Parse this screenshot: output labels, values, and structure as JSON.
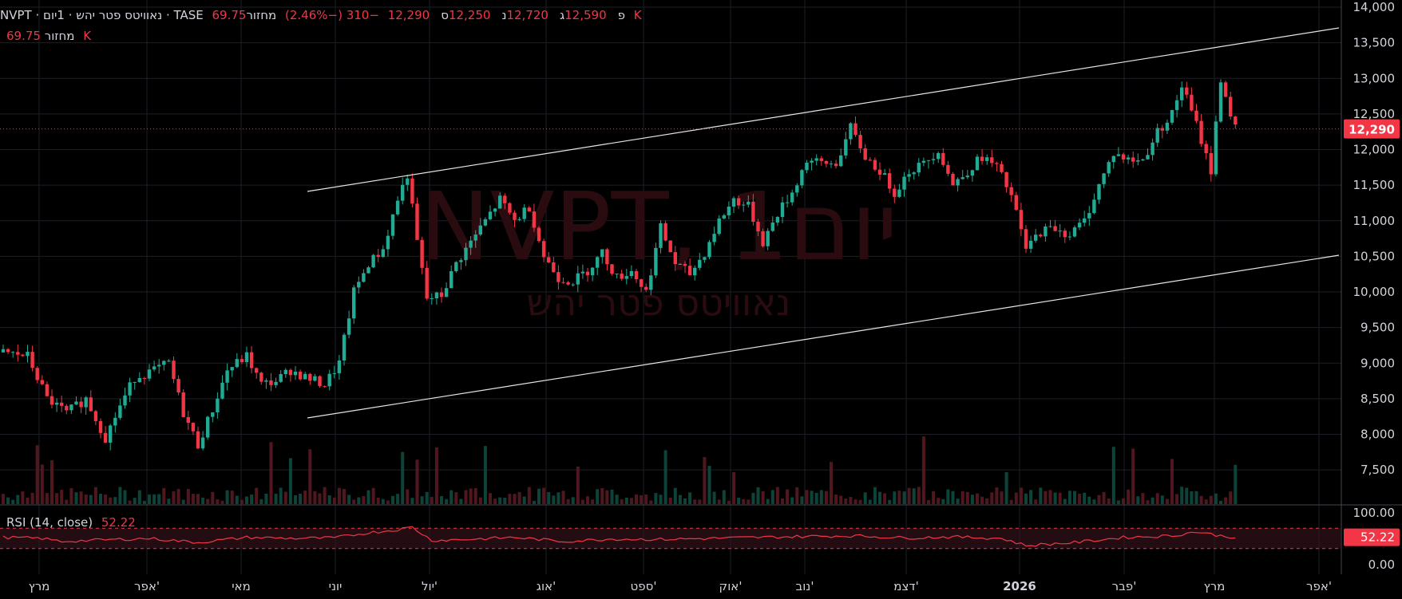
{
  "header": {
    "line1_parts": [
      "NVPT",
      "·",
      "נאוויטס פטר יהש",
      "·",
      "1יום",
      "·",
      "TASE"
    ],
    "ohlc": [
      {
        "label": "פ",
        "value": "12,590"
      },
      {
        "label": "ג",
        "value": "12,720"
      },
      {
        "label": "נ",
        "value": "12,250"
      },
      {
        "label": "ס",
        "value": "12,290"
      }
    ],
    "change": "−310 (−2.46%)",
    "volume_label": "מחזור",
    "volume_value": "69.75 K",
    "line2_label": "מחזור",
    "line2_value": "69.75 K"
  },
  "watermark": {
    "big": "NVPT, 1יום",
    "small": "נאוויטס פטר יהש"
  },
  "price_badge": "12,290",
  "rsi": {
    "label": "RSI (14, close)",
    "value": "52.22",
    "badge": "52.22"
  },
  "colors": {
    "up": "#22ab94",
    "down": "#f23645",
    "grid": "#1c1f26",
    "rsi_line": "#f23645",
    "rsi_band": "#3a1620"
  },
  "chart_data": {
    "type": "candlestick",
    "title": "NVPT · נאוויטס פטר יהש · 1יום · TASE",
    "y_axis_ticks": [
      "14,000",
      "13,500",
      "13,000",
      "12,500",
      "12,000",
      "11,500",
      "11,000",
      "10,500",
      "10,000",
      "9,500",
      "9,000",
      "8,500",
      "8,000",
      "7,500"
    ],
    "ylim": [
      7300,
      14000
    ],
    "x_axis_ticks": [
      "מרץ",
      "אפר'",
      "מאי",
      "יוני",
      "יול'",
      "אוג'",
      "ספט'",
      "אוק'",
      "נוב'",
      "דצמ'",
      "2026",
      "פבר'",
      "מרץ",
      "אפר'"
    ],
    "rsi_axis_ticks": [
      "100.00",
      "0.00"
    ],
    "rsi_levels": [
      70,
      30
    ],
    "last_close": 12290,
    "channel_lines": [
      {
        "from": [
          "יוני",
          8400
        ],
        "to": [
          "אפר'",
          13700
        ]
      },
      {
        "from": [
          "יוני",
          11500
        ],
        "to": [
          "אפר'",
          10600
        ]
      }
    ],
    "price_path": [
      [
        0,
        9150
      ],
      [
        5,
        9100
      ],
      [
        9,
        8500
      ],
      [
        13,
        8300
      ],
      [
        17,
        8500
      ],
      [
        21,
        7950
      ],
      [
        24,
        8400
      ],
      [
        27,
        8800
      ],
      [
        31,
        8900
      ],
      [
        34,
        9000
      ],
      [
        37,
        8300
      ],
      [
        40,
        7850
      ],
      [
        43,
        8350
      ],
      [
        46,
        8900
      ],
      [
        50,
        9100
      ],
      [
        53,
        8700
      ],
      [
        56,
        8750
      ],
      [
        59,
        8900
      ],
      [
        62,
        8800
      ],
      [
        66,
        8700
      ],
      [
        69,
        9000
      ],
      [
        72,
        10000
      ],
      [
        75,
        10400
      ],
      [
        78,
        10600
      ],
      [
        81,
        11300
      ],
      [
        83,
        11650
      ],
      [
        85,
        10700
      ],
      [
        87,
        9900
      ],
      [
        90,
        9950
      ],
      [
        93,
        10400
      ],
      [
        96,
        10700
      ],
      [
        99,
        11000
      ],
      [
        102,
        11300
      ],
      [
        105,
        11000
      ],
      [
        108,
        11200
      ],
      [
        111,
        10500
      ],
      [
        114,
        10200
      ],
      [
        117,
        10150
      ],
      [
        120,
        10300
      ],
      [
        123,
        10550
      ],
      [
        126,
        10200
      ],
      [
        129,
        10300
      ],
      [
        132,
        10000
      ],
      [
        135,
        10900
      ],
      [
        138,
        10400
      ],
      [
        141,
        10250
      ],
      [
        144,
        10550
      ],
      [
        147,
        11000
      ],
      [
        150,
        11300
      ],
      [
        153,
        11200
      ],
      [
        156,
        10700
      ],
      [
        159,
        11100
      ],
      [
        162,
        11400
      ],
      [
        165,
        11850
      ],
      [
        168,
        11800
      ],
      [
        171,
        11800
      ],
      [
        174,
        12300
      ],
      [
        177,
        11900
      ],
      [
        180,
        11700
      ],
      [
        183,
        11400
      ],
      [
        186,
        11700
      ],
      [
        189,
        11800
      ],
      [
        192,
        12000
      ],
      [
        195,
        11500
      ],
      [
        198,
        11700
      ],
      [
        201,
        11900
      ],
      [
        204,
        11750
      ],
      [
        207,
        11350
      ],
      [
        210,
        10600
      ],
      [
        213,
        10850
      ],
      [
        216,
        10900
      ],
      [
        219,
        10800
      ],
      [
        222,
        11000
      ],
      [
        225,
        11500
      ],
      [
        228,
        11950
      ],
      [
        231,
        11850
      ],
      [
        234,
        11850
      ],
      [
        237,
        12250
      ],
      [
        240,
        12500
      ],
      [
        242,
        12900
      ],
      [
        245,
        12350
      ],
      [
        248,
        11700
      ],
      [
        250,
        13000
      ],
      [
        252,
        12500
      ],
      [
        253,
        12290
      ]
    ],
    "rsi_path": [
      [
        0,
        52
      ],
      [
        8,
        50
      ],
      [
        12,
        44
      ],
      [
        20,
        47
      ],
      [
        30,
        50
      ],
      [
        40,
        42
      ],
      [
        50,
        52
      ],
      [
        60,
        50
      ],
      [
        68,
        51
      ],
      [
        74,
        60
      ],
      [
        80,
        66
      ],
      [
        84,
        72
      ],
      [
        88,
        46
      ],
      [
        95,
        48
      ],
      [
        105,
        52
      ],
      [
        115,
        44
      ],
      [
        125,
        49
      ],
      [
        135,
        48
      ],
      [
        145,
        50
      ],
      [
        155,
        52
      ],
      [
        165,
        54
      ],
      [
        175,
        55
      ],
      [
        185,
        51
      ],
      [
        195,
        53
      ],
      [
        205,
        50
      ],
      [
        210,
        36
      ],
      [
        220,
        42
      ],
      [
        230,
        52
      ],
      [
        240,
        55
      ],
      [
        245,
        63
      ],
      [
        250,
        55
      ],
      [
        253,
        52
      ]
    ]
  }
}
